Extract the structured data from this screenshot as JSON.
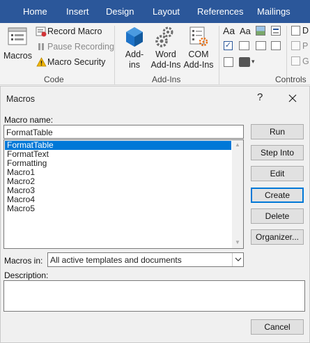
{
  "ribbon": {
    "tabs": [
      "Home",
      "Insert",
      "Design",
      "Layout",
      "References",
      "Mailings"
    ],
    "code_group": {
      "macros_label": "Macros",
      "record_macro": "Record Macro",
      "pause_recording": "Pause Recording",
      "macro_security": "Macro Security",
      "group_name": "Code"
    },
    "addins_group": {
      "addins_line1": "Add-",
      "addins_line2": "ins",
      "word_addins_line1": "Word",
      "word_addins_line2": "Add-Ins",
      "com_addins_line1": "COM",
      "com_addins_line2": "Add-Ins",
      "group_name": "Add-Ins"
    },
    "controls_group": {
      "group_name": "Controls",
      "aa_large": "Aa",
      "aa_small": "Aa"
    },
    "colors": {
      "tab_bar": "#2b579a",
      "accent_blue": "#1e73c8",
      "warning": "#f0b400"
    }
  },
  "dialog": {
    "title": "Macros",
    "help": "?",
    "macro_name_label": "Macro name:",
    "macro_name_value": "FormatTable",
    "macro_list": [
      "FormatTable",
      "FormatText",
      "Formatting",
      "Macro1",
      "Macro2",
      "Macro3",
      "Macro4",
      "Macro5"
    ],
    "selected_index": 0,
    "macros_in_label": "Macros in:",
    "macros_in_value": "All active templates and documents",
    "description_label": "Description:",
    "description_value": "",
    "buttons": {
      "run": "Run",
      "step_into": "Step Into",
      "edit": "Edit",
      "create": "Create",
      "delete": "Delete",
      "organizer": "Organizer...",
      "cancel": "Cancel"
    }
  }
}
